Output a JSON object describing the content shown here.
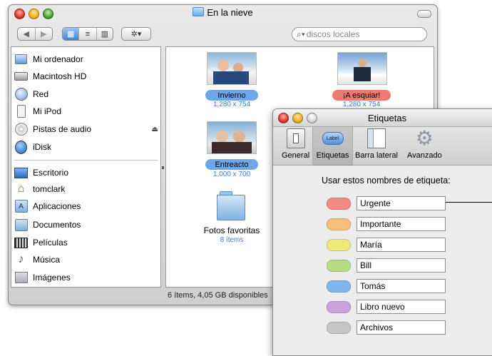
{
  "finder": {
    "title": "En la nieve",
    "search_placeholder": "discos locales",
    "sidebar": {
      "devices": [
        {
          "label": "Mi ordenador",
          "icon": "computer-icon"
        },
        {
          "label": "Macintosh HD",
          "icon": "hard-drive-icon"
        },
        {
          "label": "Red",
          "icon": "network-icon"
        },
        {
          "label": "Mi iPod",
          "icon": "ipod-icon"
        },
        {
          "label": "Pistas de audio",
          "icon": "audio-cd-icon"
        },
        {
          "label": "iDisk",
          "icon": "idisk-icon"
        }
      ],
      "places": [
        {
          "label": "Escritorio",
          "icon": "desktop-icon"
        },
        {
          "label": "tomclark",
          "icon": "home-icon"
        },
        {
          "label": "Aplicaciones",
          "icon": "applications-icon"
        },
        {
          "label": "Documentos",
          "icon": "documents-folder-icon"
        },
        {
          "label": "Películas",
          "icon": "movies-icon"
        },
        {
          "label": "Música",
          "icon": "music-icon"
        },
        {
          "label": "Imágenes",
          "icon": "pictures-icon"
        }
      ]
    },
    "items": [
      {
        "name": "Invierno",
        "info": "1,280 x 754",
        "label_color": "#6fa6e8"
      },
      {
        "name": "¡A esquiar!",
        "info": "1,280 x 754",
        "label_color": "#f07a70"
      },
      {
        "name": "Entreacto",
        "info": "1,000 x 700",
        "label_color": "#6fa6e8"
      },
      {
        "name": "Fotos favoritas",
        "info": "8 ítems",
        "label_color": ""
      }
    ],
    "status": "6 ítems, 4,05 GB disponibles"
  },
  "prefs": {
    "title": "Etiquetas",
    "toolbar": [
      {
        "label": "General",
        "icon": "general-switch-icon"
      },
      {
        "label": "Etiquetas",
        "icon": "label-tag-icon",
        "icon_text": "Label"
      },
      {
        "label": "Barra lateral",
        "icon": "sidebar-icon"
      },
      {
        "label": "Avanzado",
        "icon": "gear-icon"
      }
    ],
    "heading": "Usar estos nombres de etiqueta:",
    "labels": [
      {
        "name": "Urgente",
        "color": "#f28b86"
      },
      {
        "name": "Importante",
        "color": "#f6c07a"
      },
      {
        "name": "María",
        "color": "#efe87a"
      },
      {
        "name": "Bill",
        "color": "#b6dc84"
      },
      {
        "name": "Tomás",
        "color": "#7fb6ea"
      },
      {
        "name": "Libro nuevo",
        "color": "#c9a4dc"
      },
      {
        "name": "Archivos",
        "color": "#c6c6c6"
      }
    ]
  }
}
